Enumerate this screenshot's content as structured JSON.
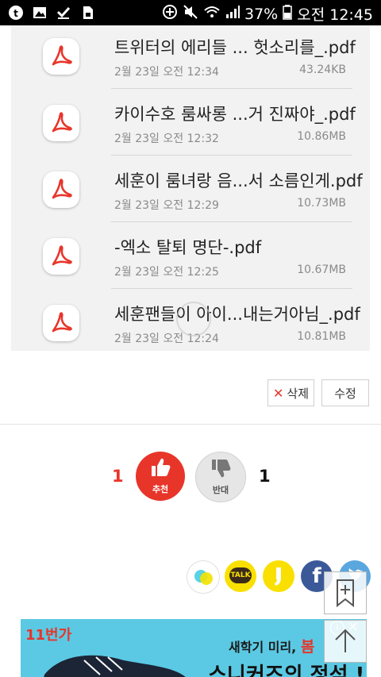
{
  "status_bar": {
    "battery_percent": "37%",
    "time": "오전 12:45",
    "icons": [
      "tumblr-icon",
      "gallery-icon",
      "check-download-icon",
      "sim-icon",
      "add-circle-icon",
      "mute-icon",
      "wifi-icon",
      "signal-icon",
      "battery-icon"
    ]
  },
  "files": [
    {
      "name": "트위터의 에리들 ... 헛소리를_.pdf",
      "date": "2월 23일 오전 12:34",
      "size": "43.24KB"
    },
    {
      "name": "카이수호 룸싸롱 ...거 진짜야_.pdf",
      "date": "2월 23일 오전 12:32",
      "size": "10.86MB"
    },
    {
      "name": "세훈이 룸녀랑 음...서 소름인게.pdf",
      "date": "2월 23일 오전 12:29",
      "size": "10.73MB"
    },
    {
      "name": "-엑소 탈퇴 명단-.pdf",
      "date": "2월 23일 오전 12:25",
      "size": "10.67MB"
    },
    {
      "name": "세훈팬들이 아이...내는거아님_.pdf",
      "date": "2월 23일 오전 12:24",
      "size": "10.81MB"
    }
  ],
  "actions": {
    "delete_label": "삭제",
    "edit_label": "수정"
  },
  "votes": {
    "up_count": "1",
    "up_label": "추천",
    "down_label": "반대",
    "down_count": "1"
  },
  "share": {
    "talk_label": "TALK",
    "facebook_label": "f"
  },
  "ad": {
    "brand": "11번가",
    "line1": "새학기 미리,",
    "highlight": "봄",
    "line2": "스니커즈의 정석 !"
  },
  "colors": {
    "accent_red": "#e8352a",
    "vote_up": "#e8352a",
    "vote_down": "#e6e6e6",
    "kakao_yellow": "#f9e000",
    "facebook_blue": "#3b5998",
    "twitter_blue": "#5aa7df"
  }
}
